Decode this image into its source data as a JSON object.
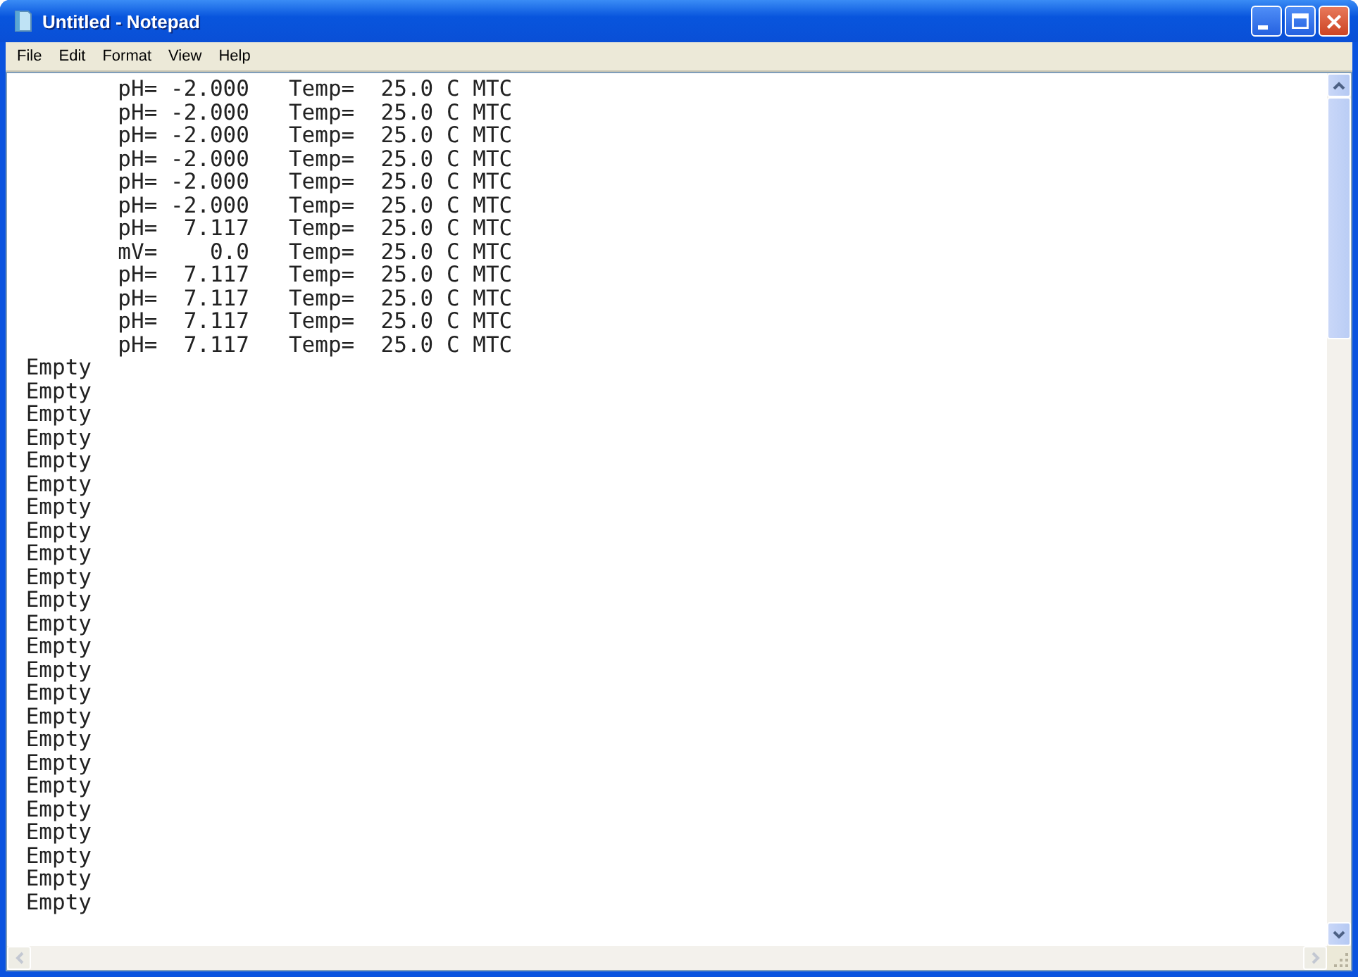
{
  "window": {
    "title": "Untitled - Notepad"
  },
  "menu": [
    "File",
    "Edit",
    "Format",
    "View",
    "Help"
  ],
  "lines": [
    "        pH= -2.000   Temp=  25.0 C MTC",
    "        pH= -2.000   Temp=  25.0 C MTC",
    "        pH= -2.000   Temp=  25.0 C MTC",
    "        pH= -2.000   Temp=  25.0 C MTC",
    "        pH= -2.000   Temp=  25.0 C MTC",
    "        pH= -2.000   Temp=  25.0 C MTC",
    "        pH=  7.117   Temp=  25.0 C MTC",
    "        mV=    0.0   Temp=  25.0 C MTC",
    "        pH=  7.117   Temp=  25.0 C MTC",
    "        pH=  7.117   Temp=  25.0 C MTC",
    "        pH=  7.117   Temp=  25.0 C MTC",
    "        pH=  7.117   Temp=  25.0 C MTC",
    " Empty",
    " Empty",
    " Empty",
    " Empty",
    " Empty",
    " Empty",
    " Empty",
    " Empty",
    " Empty",
    " Empty",
    " Empty",
    " Empty",
    " Empty",
    " Empty",
    " Empty",
    " Empty",
    " Empty",
    " Empty",
    " Empty",
    " Empty",
    " Empty",
    " Empty",
    " Empty",
    " Empty"
  ]
}
